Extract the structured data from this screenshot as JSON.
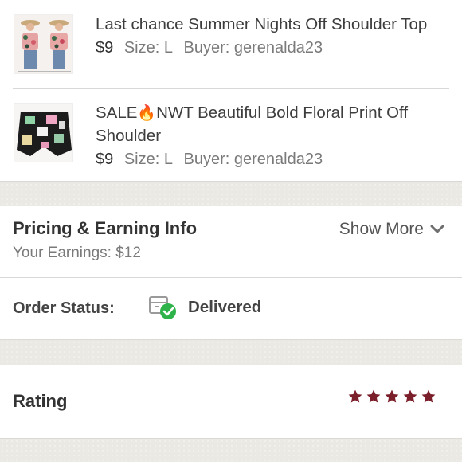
{
  "items": [
    {
      "title": "Last chance Summer Nights Off Shoulder Top",
      "price": "$9",
      "size": "Size: L",
      "buyer": "Buyer: gerenalda23"
    },
    {
      "title_prefix": "SALE",
      "title_emoji": "🔥",
      "title_rest": "NWT Beautiful Bold Floral Print Off Shoulder",
      "price": "$9",
      "size": "Size: L",
      "buyer": "Buyer: gerenalda23"
    }
  ],
  "pricing": {
    "title": "Pricing & Earning Info",
    "earnings": "Your Earnings: $12",
    "show_more": "Show More",
    "show_more_icon": "chevron-down-icon"
  },
  "order_status": {
    "label": "Order Status:",
    "value": "Delivered",
    "icon": "package-delivered-icon",
    "check_color": "#2eb34a"
  },
  "rating": {
    "label": "Rating",
    "stars": 5,
    "max_stars": 5,
    "star_color": "#7b1f2b"
  }
}
